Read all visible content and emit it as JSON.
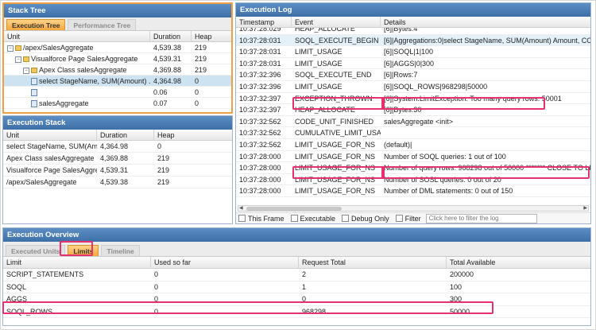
{
  "stack_tree": {
    "title": "Stack Tree",
    "tabs": [
      "Execution Tree",
      "Performance Tree"
    ],
    "columns": [
      "Unit",
      "Duration",
      "Heap"
    ],
    "rows": [
      {
        "toggle": "−",
        "icon": "folder",
        "unit": "/apex/SalesAggregate",
        "duration": "4,539.38",
        "heap": "219"
      },
      {
        "toggle": "−",
        "icon": "folder",
        "unit": "Visualforce Page SalesAggregate",
        "duration": "4,539.31",
        "heap": "219"
      },
      {
        "toggle": "−",
        "icon": "folder",
        "unit": "Apex Class salesAggregate",
        "duration": "4,369.88",
        "heap": "219"
      },
      {
        "toggle": "",
        "icon": "doc",
        "unit": "select StageName, SUM(Amount) ...",
        "duration": "4,364.98",
        "heap": "0"
      },
      {
        "toggle": "",
        "icon": "doc",
        "unit": "",
        "duration": "0.06",
        "heap": "0"
      },
      {
        "toggle": "",
        "icon": "doc",
        "unit": "salesAggregate",
        "duration": "0.07",
        "heap": "0"
      }
    ]
  },
  "execution_stack": {
    "title": "Execution Stack",
    "columns": [
      "Unit",
      "Duration",
      "Heap"
    ],
    "rows": [
      {
        "unit": "select StageName, SUM(Amo...",
        "duration": "4,364.98",
        "heap": "0"
      },
      {
        "unit": "Apex Class salesAggregate",
        "duration": "4,369.88",
        "heap": "219"
      },
      {
        "unit": "Visualforce Page SalesAggreg...",
        "duration": "4,539.31",
        "heap": "219"
      },
      {
        "unit": "/apex/SalesAggregate",
        "duration": "4,539.38",
        "heap": "219"
      }
    ]
  },
  "execution_log": {
    "title": "Execution Log",
    "columns": [
      "Timestamp",
      "Event",
      "Details"
    ],
    "rows": [
      {
        "ts": "10:37:28:029",
        "event": "HEAP_ALLOCATE",
        "details": "[6]|Bytes:4"
      },
      {
        "ts": "10:37:28:031",
        "event": "SOQL_EXECUTE_BEGIN",
        "details": "[6]|Aggregations:0|select StageName, SUM(Amount) Amount, COUNT(id)"
      },
      {
        "ts": "10:37:28:031",
        "event": "LIMIT_USAGE",
        "details": "[6]|SOQL|1|100"
      },
      {
        "ts": "10:37:28:031",
        "event": "LIMIT_USAGE",
        "details": "[6]|AGGS|0|300"
      },
      {
        "ts": "10:37:32:396",
        "event": "SOQL_EXECUTE_END",
        "details": "[6]|Rows:7"
      },
      {
        "ts": "10:37:32:396",
        "event": "LIMIT_USAGE",
        "details": "[6]|SOQL_ROWS|968298|50000"
      },
      {
        "ts": "10:37:32:397",
        "event": "EXCEPTION_THROWN",
        "details": "[6]|System.LimitException: Too many query rows: 50001"
      },
      {
        "ts": "10:37:32:397",
        "event": "HEAP_ALLOCATE",
        "details": "[6]|Bytes:30"
      },
      {
        "ts": "10:37:32:562",
        "event": "CODE_UNIT_FINISHED",
        "details": "salesAggregate <init>"
      },
      {
        "ts": "10:37:32:562",
        "event": "CUMULATIVE_LIMIT_USAGE",
        "details": ""
      },
      {
        "ts": "10:37:32:562",
        "event": "LIMIT_USAGE_FOR_NS",
        "details": "(default)|"
      },
      {
        "ts": "10:37:28:000",
        "event": "LIMIT_USAGE_FOR_NS",
        "details": "Number of SOQL queries: 1 out of 100"
      },
      {
        "ts": "10:37:28:000",
        "event": "LIMIT_USAGE_FOR_NS",
        "details": "Number of query rows: 968298 out of 50000 ******* CLOSE TO LIMIT"
      },
      {
        "ts": "10:37:28:000",
        "event": "LIMIT_USAGE_FOR_NS",
        "details": "Number of SOSL queries: 0 out of 20"
      },
      {
        "ts": "10:37:28:000",
        "event": "LIMIT_USAGE_FOR_NS",
        "details": "Number of DML statements: 0 out of 150"
      }
    ],
    "filters": {
      "this_frame": "This Frame",
      "executable": "Executable",
      "debug_only": "Debug Only",
      "filter": "Filter",
      "filter_placeholder": "Click here to filter the log"
    }
  },
  "execution_overview": {
    "title": "Execution Overview",
    "tabs": [
      "Executed Units",
      "Limits",
      "Timeline"
    ],
    "columns": [
      "Limit",
      "Used so far",
      "Request Total",
      "Total Available"
    ],
    "rows": [
      {
        "limit": "SCRIPT_STATEMENTS",
        "used": "0",
        "request": "2",
        "available": "200000"
      },
      {
        "limit": "SOQL",
        "used": "0",
        "request": "1",
        "available": "100"
      },
      {
        "limit": "AGGS",
        "used": "0",
        "request": "0",
        "available": "300"
      },
      {
        "limit": "SOQL_ROWS",
        "used": "0",
        "request": "968298",
        "available": "50000"
      }
    ]
  },
  "colors": {
    "header_blue": "#4a7db5",
    "active_tab": "#f3a73a",
    "highlight_pink": "#e8306f",
    "frame_orange": "#f0a040",
    "selection": "#cde3f1"
  }
}
